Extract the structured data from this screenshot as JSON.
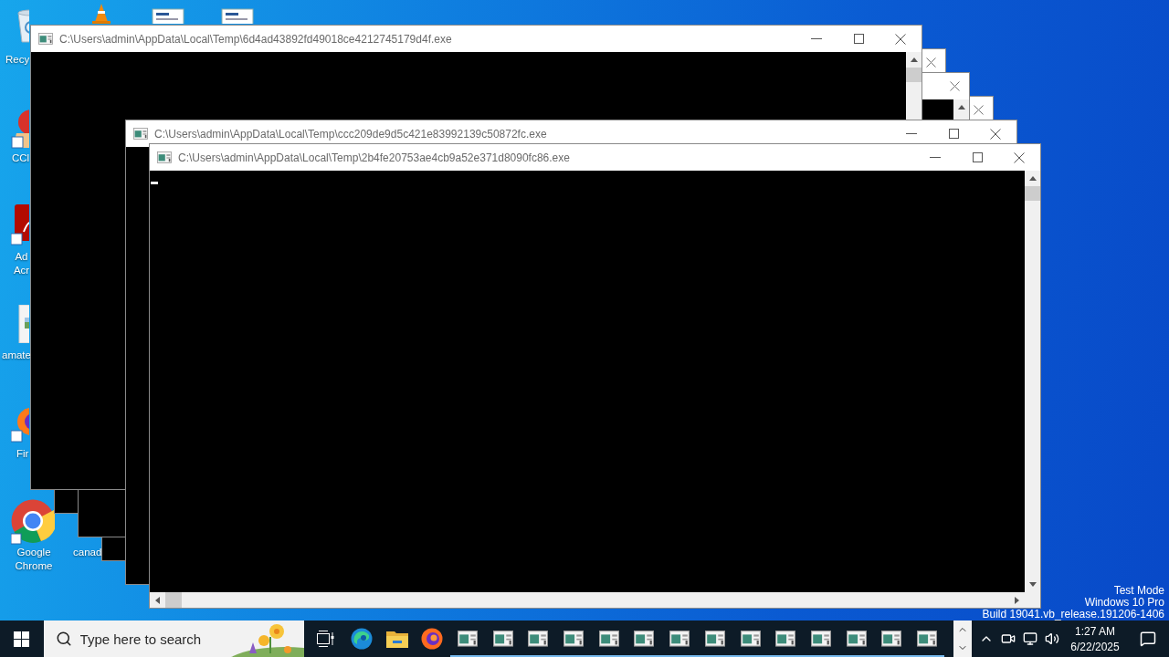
{
  "desktop": {
    "icons": [
      {
        "kind": "recycle-bin",
        "label": "Recy"
      },
      {
        "kind": "cone"
      },
      {
        "kind": "document"
      },
      {
        "kind": "document"
      },
      {
        "kind": "broom",
        "label": "CCl"
      },
      {
        "kind": "acrobat",
        "label": "Ad Acr"
      },
      {
        "kind": "image",
        "label": "amate"
      },
      {
        "kind": "firefox",
        "label": "Fir"
      },
      {
        "kind": "chrome",
        "label": "Google Chrome"
      },
      {
        "kind": "hidden",
        "label": "canad"
      }
    ],
    "watermark": [
      "Test Mode",
      "Windows 10 Pro",
      "Build 19041.vb_release.191206-1406"
    ]
  },
  "windows": [
    {
      "kind": "console"
    },
    {
      "kind": "console"
    },
    {
      "kind": "console"
    },
    {
      "kind": "console",
      "title": "C:\\Users\\admin\\AppData\\Local\\Temp\\6d4ad43892fd49018ce4212745179d4f.exe"
    },
    {
      "kind": "console",
      "title": "C:\\Users\\admin\\AppData\\Local\\Temp\\ccc209de9d5c421e83992139c50872fc.exe"
    },
    {
      "kind": "console",
      "title": "C:\\Users\\admin\\AppData\\Local\\Temp\\2b4fe20753ae4cb9a52e371d8090fc86.exe",
      "horizontal_scrollbar": true,
      "cursor": true
    }
  ],
  "taskbar": {
    "search": {
      "placeholder": "Type here to search"
    },
    "pinned": [
      {
        "kind": "task-view"
      },
      {
        "kind": "edge"
      },
      {
        "kind": "folder"
      },
      {
        "kind": "firefox"
      }
    ],
    "running": [
      {
        "kind": "console"
      },
      {
        "kind": "console"
      },
      {
        "kind": "console"
      },
      {
        "kind": "console"
      },
      {
        "kind": "console"
      },
      {
        "kind": "console"
      },
      {
        "kind": "console"
      },
      {
        "kind": "console"
      },
      {
        "kind": "console"
      },
      {
        "kind": "console"
      },
      {
        "kind": "console"
      },
      {
        "kind": "console"
      },
      {
        "kind": "console"
      },
      {
        "kind": "console"
      }
    ],
    "clock": {
      "time": "1:27 AM",
      "date": "6/22/2025"
    }
  }
}
